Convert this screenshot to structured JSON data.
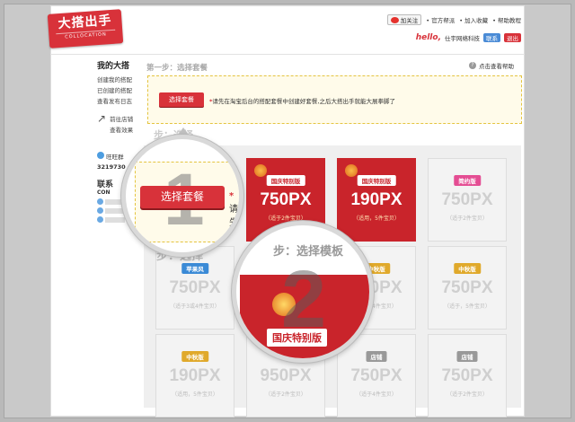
{
  "logo": {
    "title": "大搭出手",
    "subtitle": "COLLOCATION"
  },
  "toplinks": {
    "follow": "加关注",
    "items": [
      "官方帮派",
      "加入收藏",
      "帮助教程"
    ]
  },
  "userbar": {
    "hello": "hello,",
    "user": "仕宇网络科技",
    "tag1": "联系",
    "tag2": "退出"
  },
  "sidebar": {
    "title": "我的大搭",
    "links": [
      "创建我的搭配",
      "已创建的搭配",
      "查看发布日志"
    ],
    "goto": [
      "前往店铺",
      "查看效果"
    ],
    "qq_label": "旺旺群",
    "qq_number": "3219730",
    "contact": "联系",
    "con": "CON"
  },
  "main": {
    "step1_title": "第一步：选择套餐",
    "help": "点击查看帮助",
    "select_button": "选择套餐",
    "tip_mark": "*",
    "tip": "请先在淘宝后台的搭配套餐中创建好套餐,之后大搭出手就能大展拳脚了",
    "step_bg": "步：选择"
  },
  "cards": [
    {
      "badge": "国庆特别版",
      "size": "750PX",
      "sub": "（适于2件宝贝）",
      "style": "red",
      "badge_style": ""
    },
    {
      "badge": "国庆特别版",
      "size": "190PX",
      "sub": "（适用，5件宝贝）",
      "style": "red",
      "badge_style": ""
    },
    {
      "badge": "简约版",
      "size": "750PX",
      "sub": "（适于2件宝贝）",
      "style": "gray",
      "badge_style": "pink"
    },
    {
      "badge": "苹果风",
      "size": "750PX",
      "sub": "（适于3或4件宝贝）",
      "style": "gray",
      "badge_style": "blue"
    },
    {
      "badge": "中秋版",
      "size": "750PX",
      "sub": "（适于4件宝贝）",
      "style": "gray",
      "badge_style": "gold"
    },
    {
      "badge": "中秋版",
      "size": "750PX",
      "sub": "（适于，5件宝贝）",
      "style": "gray",
      "badge_style": "gold"
    },
    {
      "badge": "中秋版",
      "size": "190PX",
      "sub": "（适用，5件宝贝）",
      "style": "gray",
      "badge_style": "gold"
    },
    {
      "badge": "",
      "size": "950PX",
      "sub": "（适于2件宝贝）",
      "style": "gray",
      "badge_style": ""
    },
    {
      "badge": "店铺",
      "size": "750PX",
      "sub": "（适于4件宝贝）",
      "style": "gray",
      "badge_style": "gray"
    },
    {
      "badge": "店铺",
      "size": "750PX",
      "sub": "（适于2件宝贝）",
      "style": "gray",
      "badge_style": "gray"
    }
  ],
  "mag1": {
    "num": "1",
    "button": "选择套餐",
    "tip_mark": "*",
    "tip": "请先"
  },
  "mag2": {
    "num": "2",
    "head": "步：选择模板",
    "label": "国庆特别版"
  },
  "bg_step2": "步：选择"
}
